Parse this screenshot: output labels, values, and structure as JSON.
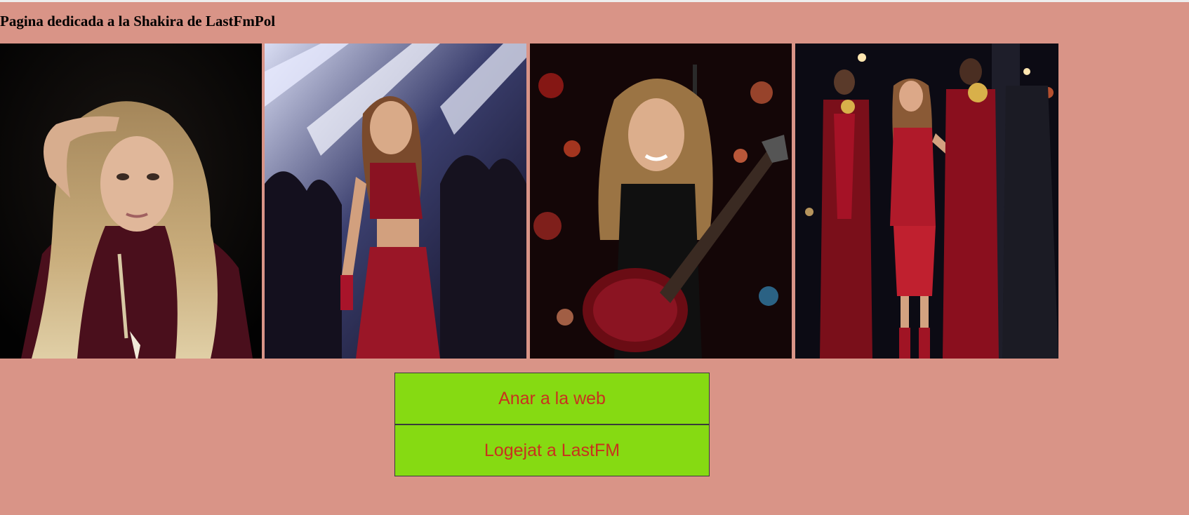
{
  "page": {
    "title": "Pagina dedicada a la Shakira de LastFmPol",
    "background_color": "#d99487"
  },
  "gallery": {
    "photos": [
      {
        "subject": "Shakira portrait with long blonde wavy hair, hand on head"
      },
      {
        "subject": "Shakira on stage in red sequined outfit"
      },
      {
        "subject": "Shakira smiling with red acoustic guitar at microphone"
      },
      {
        "subject": "Shakira dancing on stage with two trumpet players in red suits"
      }
    ]
  },
  "buttons": {
    "web_label": "Anar a la web",
    "login_label": "Logejat a LastFM",
    "fill_color": "#86da12",
    "text_color": "#c8321e"
  }
}
